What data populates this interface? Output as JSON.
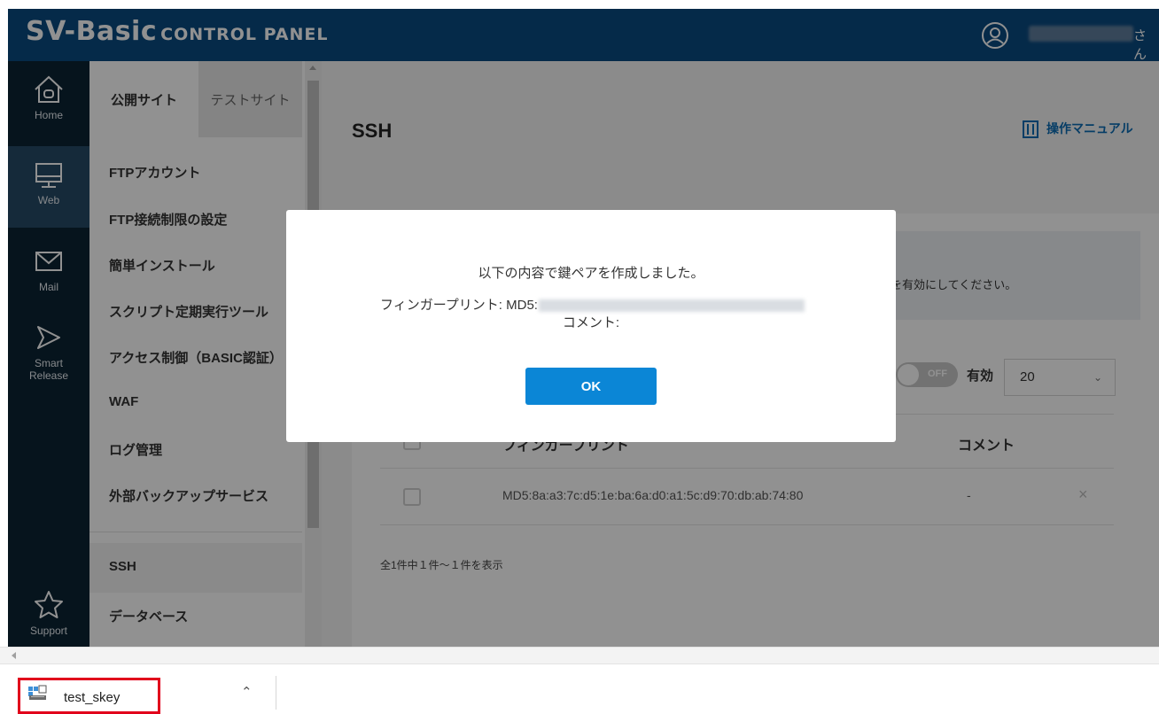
{
  "header": {
    "logo_main": "SV-Basic",
    "logo_sub": "CONTROL PANEL",
    "user_suffix": "さん"
  },
  "rail": [
    {
      "label": "Home",
      "icon": "home-icon"
    },
    {
      "label": "Web",
      "icon": "monitor-icon"
    },
    {
      "label": "Mail",
      "icon": "mail-icon"
    },
    {
      "label": "Smart",
      "label2": "Release",
      "icon": "smart-release-icon"
    },
    {
      "label": "Support",
      "icon": "star-icon"
    }
  ],
  "submenu": {
    "tab_public": "公開サイト",
    "tab_test": "テストサイト",
    "items": [
      "FTPアカウント",
      "FTP接続制限の設定",
      "簡単インストール",
      "スクリプト定期実行ツール",
      "アクセス制御（BASIC認証）",
      "WAF",
      "ログ管理",
      "外部バックアップサービス"
    ],
    "ssh": "SSH",
    "database": "データベース"
  },
  "main": {
    "title": "SSH",
    "manual": "操作マニュアル",
    "notice_tail": "を有効にしてください。",
    "toggle_label": "OFF",
    "enable_label": "有効",
    "per_page": "20",
    "col_fingerprint": "フィンガープリント",
    "col_comment": "コメント",
    "row_fingerprint": "MD5:8a:a3:7c:d5:1e:ba:6a:d0:a1:5c:d9:70:db:ab:74:80",
    "row_comment": "-",
    "row_delete": "×",
    "pager_info": "全1件中１件～１件を表示"
  },
  "modal": {
    "message": "以下の内容で鍵ペアを作成しました。",
    "fingerprint_label": "フィンガープリント: MD5:",
    "comment_label": "コメント:",
    "ok_label": "OK"
  },
  "download": {
    "file_name": "test_skey",
    "highlight_color": "#e1001b"
  },
  "colors": {
    "header": "#0a4a80",
    "rail": "#0c2434",
    "accent": "#0b86d6"
  }
}
